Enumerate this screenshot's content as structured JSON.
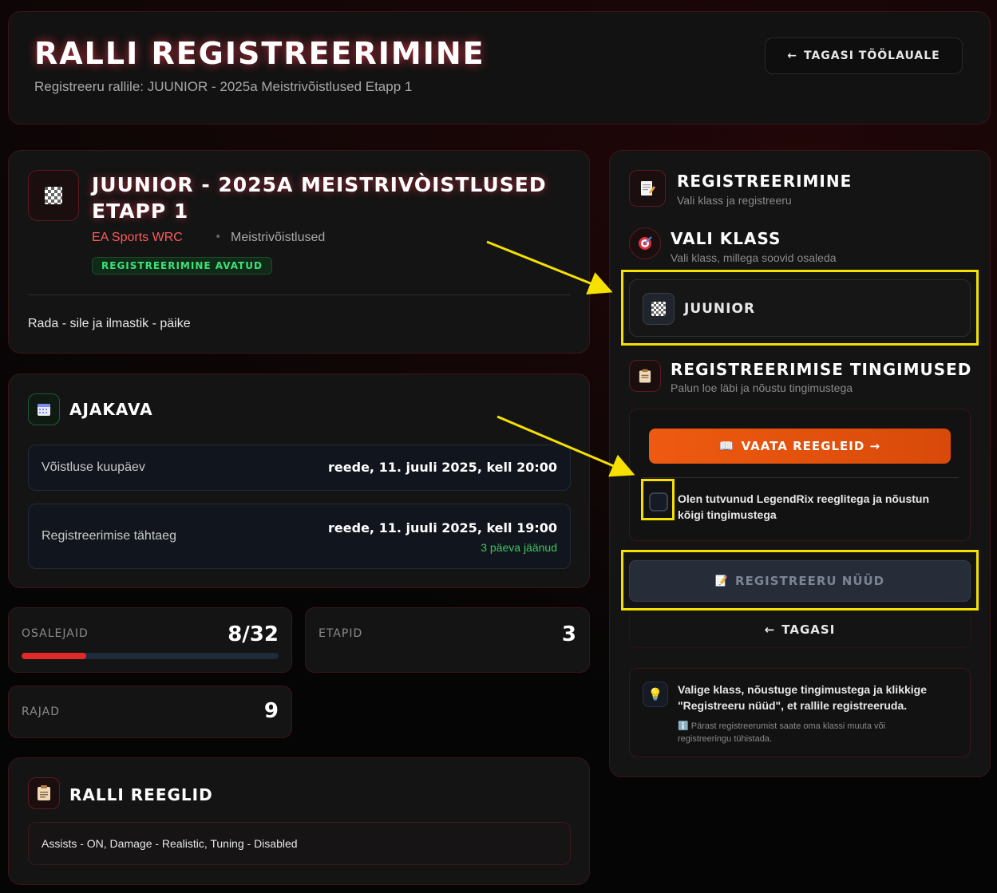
{
  "header": {
    "title": "RALLI REGISTREERIMINE",
    "subtitle": "Registreeru rallile: JUUNIOR - 2025a Meistrivõistlused Etapp 1",
    "back_label": "TAGASI TÖÖLAUALE",
    "back_arrow": "←"
  },
  "rally": {
    "icon": "checkered-flag-icon",
    "title": "JUUNIOR - 2025a Meistrivòistlused Etapp 1",
    "game": "EA Sports WRC",
    "dot": "•",
    "type": "Meistrivõistlused",
    "status": "REGISTREERIMINE AVATUD",
    "description": "Rada - sile ja ilmastik - päike"
  },
  "schedule": {
    "icon": "calendar-icon",
    "title": "AJAKAVA",
    "rows": [
      {
        "label": "Võistluse kuupäev",
        "value": "reede, 11. juuli 2025, kell 20:00"
      },
      {
        "label": "Registreerimise tähtaeg",
        "value": "reede, 11. juuli 2025, kell 19:00",
        "remaining": "3 päeva jäänud"
      }
    ]
  },
  "stats": {
    "participants": {
      "label": "OSALEJAID",
      "value": "8/32",
      "fill_fraction": 0.25
    },
    "stages": {
      "label": "ETAPID",
      "value": "3"
    },
    "tracks": {
      "label": "RAJAD",
      "value": "9"
    }
  },
  "rules": {
    "icon": "clipboard-icon",
    "title": "RALLI REEGLID",
    "text": "Assists - ON, Damage - Realistic, Tuning - Disabled"
  },
  "registration": {
    "title": "REGISTREERIMINE",
    "subtitle": "Vali klass ja registreeru",
    "class_title": "VALI KLASS",
    "class_subtitle": "Vali klass, millega soovid osaleda",
    "class_option": "JUUNIOR",
    "terms_title": "REGISTREERIMISE TINGIMUSED",
    "terms_subtitle": "Palun loe läbi ja nõustu tingimustega",
    "rules_button": "VAATA REEGLEID →",
    "rules_button_icon": "📖",
    "terms_checkbox_label": "Olen tutvunud LegendRix reeglitega ja nõustun kõigi tingimustega",
    "register_button": "REGISTREERU NÜÜD",
    "register_icon": "📝",
    "back_button": "TAGASI",
    "back_arrow": "←",
    "hint_icon": "💡",
    "hint_text": "Valige klass, nõustuge tingimustega ja klikkige \"Registreeru nüüd\", et rallile registreeruda.",
    "hint_note": "ℹ️ Pärast registreerumist saate oma klassi muuta või registreeringu tühistada."
  },
  "colors": {
    "accent_red": "#e02a2a",
    "orange": "#ee5a10",
    "highlight": "#f5e000",
    "success_green": "#3ee07a"
  }
}
